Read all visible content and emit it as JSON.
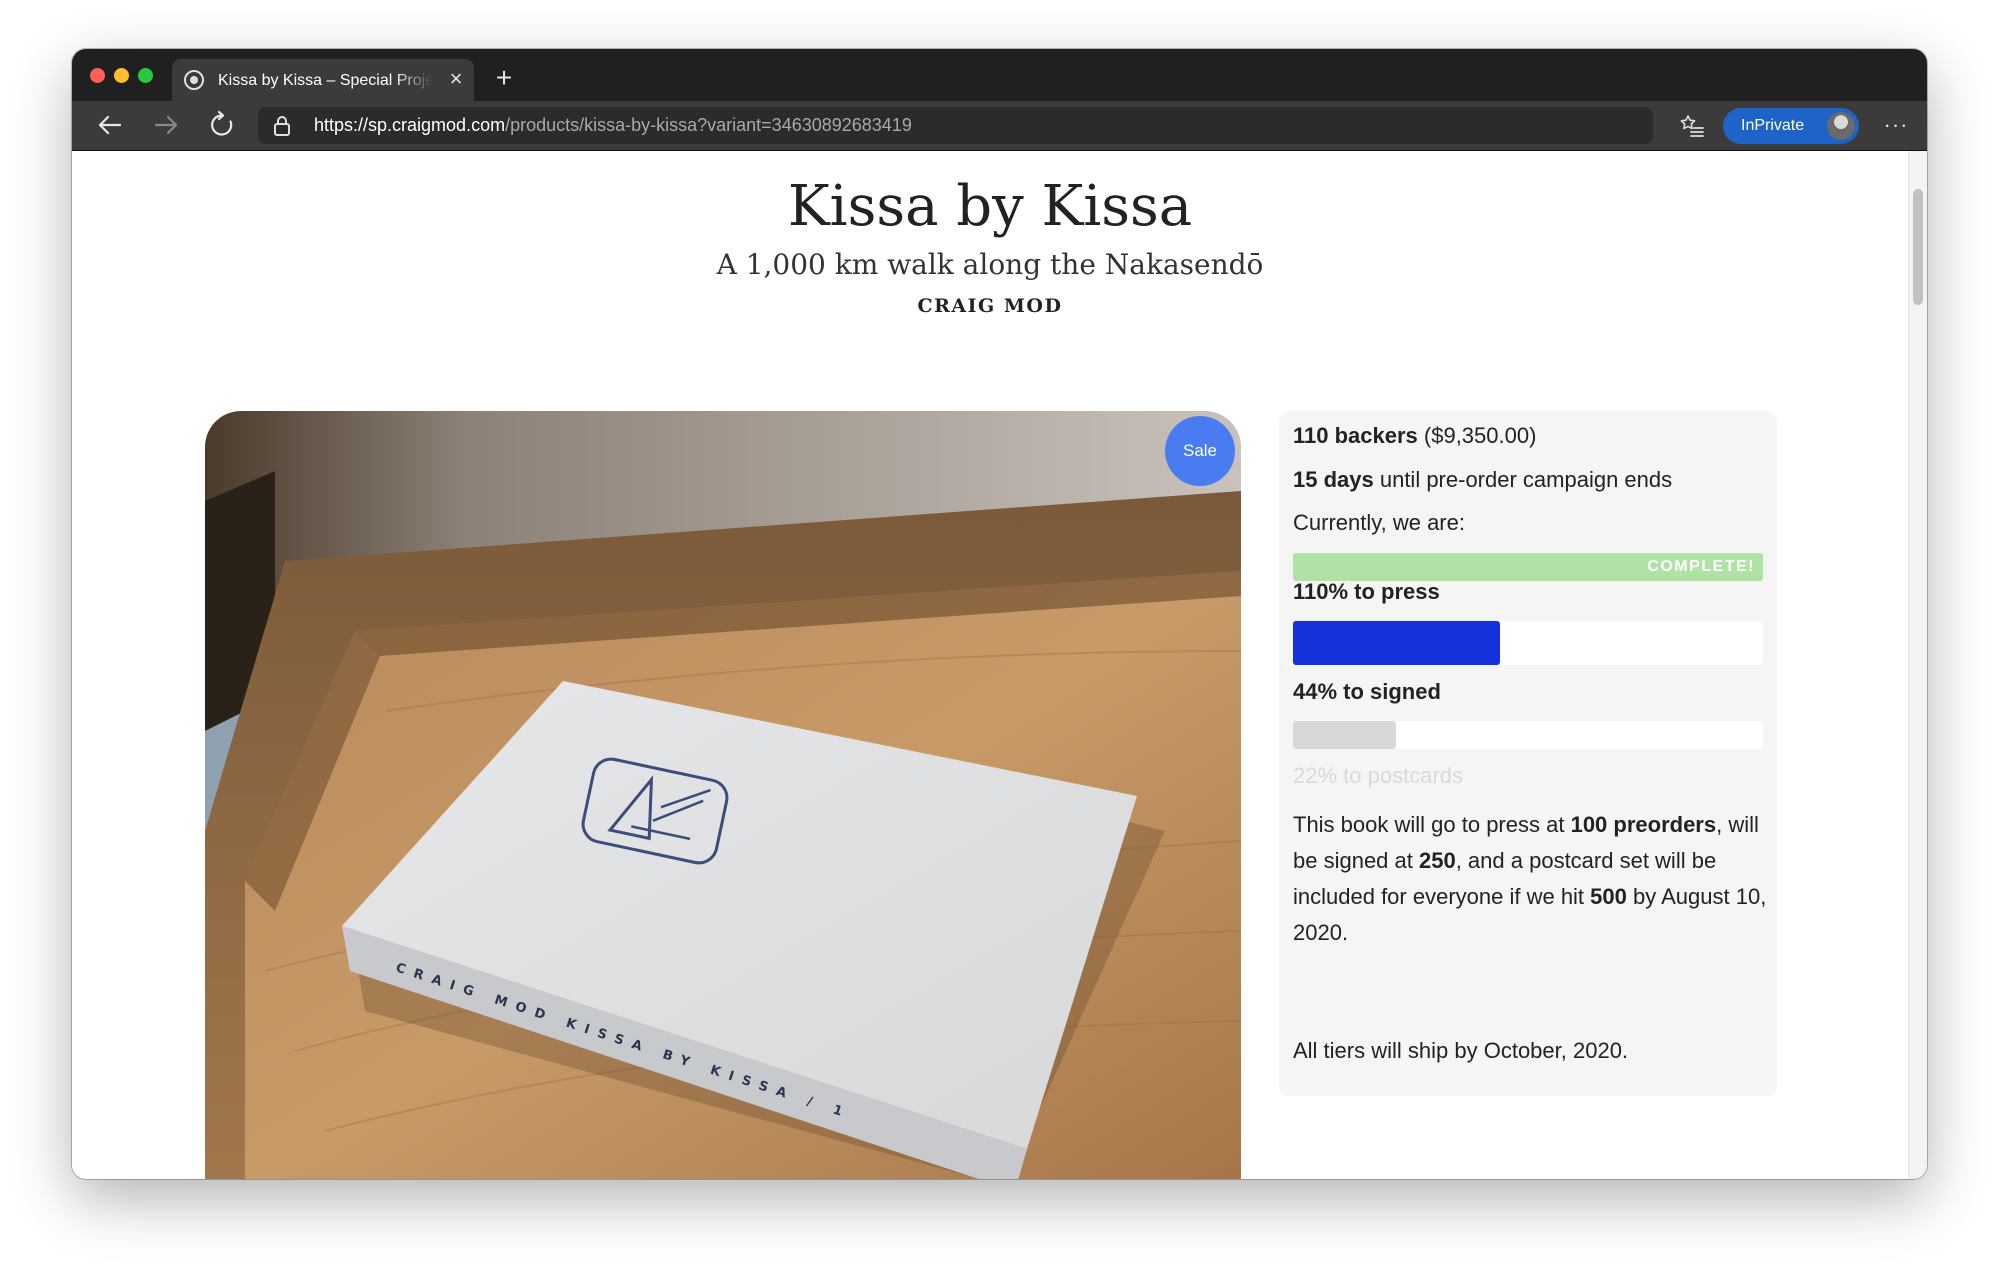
{
  "browser": {
    "tab_title": "Kissa by Kissa – Special Projects",
    "tab_close": "×",
    "new_tab": "+",
    "url_host": "https://sp.craigmod.com",
    "url_path": "/products/kissa-by-kissa?variant=34630892683419",
    "inprivate_label": "InPrivate",
    "more_label": "···"
  },
  "product": {
    "title": "Kissa by Kissa",
    "subtitle": "A 1,000 km walk along the Nakasendō",
    "author": "CRAIG MOD",
    "sale_badge": "Sale",
    "image_alt": "Kissa by Kissa book on a wooden tray",
    "spine_text": "CRAIG MOD   KISSA BY KISSA   / 1"
  },
  "campaign": {
    "backers_count": "110 backers",
    "backers_amount": " ($9,350.00)",
    "days_left": "15 days",
    "days_suffix": " until pre-order campaign ends",
    "status_intro": "Currently, we are:",
    "progress": [
      {
        "label": "110% to press",
        "percent": 110,
        "tag": "COMPLETE!",
        "color": "#b0e2a6"
      },
      {
        "label": "44% to signed",
        "percent": 44,
        "tag": "",
        "color": "#1431dc"
      },
      {
        "label": "22% to postcards",
        "percent": 22,
        "tag": "",
        "color": "#d8d8d8"
      }
    ],
    "para1": {
      "t1": "This book will go to press at ",
      "b1": "100 preorders",
      "t2": ", will be signed at ",
      "b2": "250",
      "t3": ", and a postcard set will be included for everyone if we hit ",
      "b3": "500",
      "t4": " by August 10, 2020."
    },
    "para2": "All tiers will ship by October, 2020."
  },
  "colors": {
    "chrome_dark": "#202020",
    "toolbar": "#3b3b3b",
    "inprivate_blue": "#1e63c7",
    "sale_blue": "#4a7cf1",
    "press_green": "#b0e2a6",
    "signed_blue": "#1431dc"
  },
  "icons": [
    "back-arrow-icon",
    "forward-arrow-icon",
    "reload-icon",
    "lock-icon",
    "read-aloud-icon",
    "star-icon",
    "favorites-icon",
    "more-icon",
    "close-icon",
    "plus-icon"
  ]
}
